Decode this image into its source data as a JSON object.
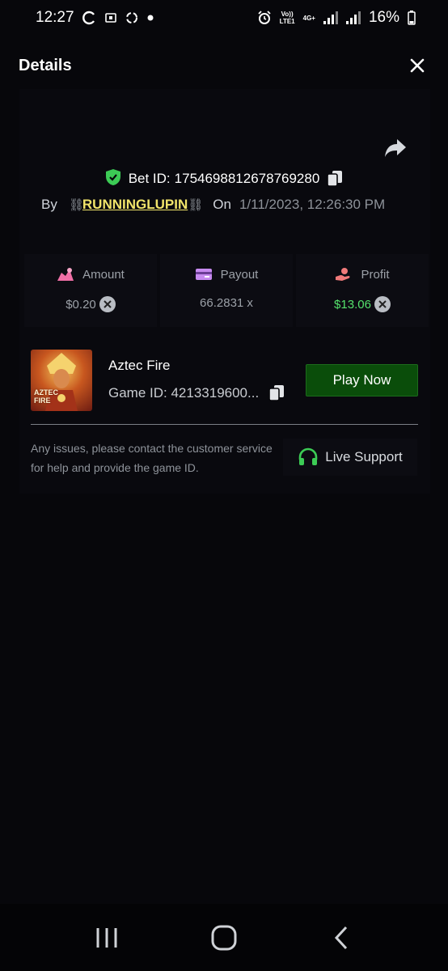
{
  "status_bar": {
    "time": "12:27",
    "battery": "16%",
    "network_top": "Vo))",
    "network_bottom": "LTE1",
    "network_type": "4G+"
  },
  "header": {
    "title": "Details"
  },
  "bet": {
    "bet_id_label": "Bet ID:",
    "bet_id": "1754698812678769280",
    "by_label": "By",
    "chain_left": "⛓",
    "username": "RUNNINGLUPIN",
    "chain_right": "⛓",
    "on_label": "On",
    "date": "1/11/2023, 12:26:30 PM"
  },
  "stats": {
    "amount_label": "Amount",
    "amount_value": "$0.20",
    "payout_label": "Payout",
    "payout_value": "66.2831 x",
    "profit_label": "Profit",
    "profit_value": "$13.06"
  },
  "game": {
    "name": "Aztec Fire",
    "game_id": "Game ID: 4213319600...",
    "thumb_line1": "AZTEC",
    "thumb_line2": "FIRE",
    "play_label": "Play Now"
  },
  "support": {
    "help_text": "Any issues, please contact the customer service for help and provide the game ID.",
    "button_label": "Live Support"
  },
  "colors": {
    "profit_green": "#55e26c",
    "play_button": "#0a4d0a",
    "username_yellow": "#f1e46a",
    "shield_green": "#3ccb55"
  },
  "icons": [
    "close-icon",
    "share-icon",
    "shield-check-icon",
    "copy-icon",
    "amount-icon",
    "payout-card-icon",
    "profit-hand-icon",
    "currency-x-icon",
    "headset-icon",
    "recents-icon",
    "home-icon",
    "back-icon"
  ]
}
